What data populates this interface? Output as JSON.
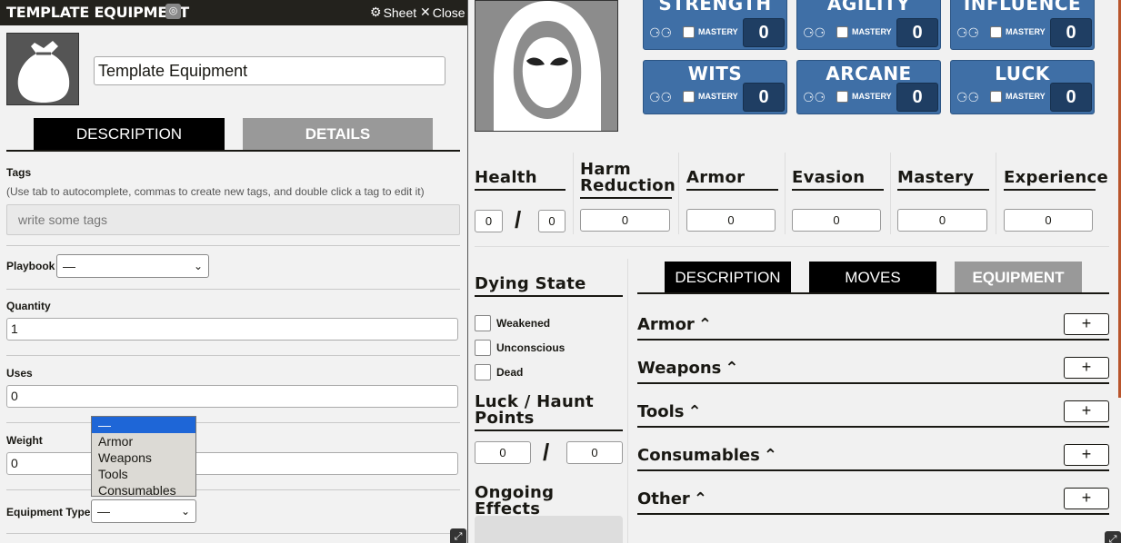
{
  "dialog": {
    "title": "TEMPLATE EQUIPMENT",
    "header_buttons": [
      {
        "icon": "gear-icon",
        "glyph": "⚙",
        "label": "Sheet"
      },
      {
        "icon": "close-icon",
        "glyph": "✕",
        "label": "Close"
      }
    ],
    "item_name": "Template Equipment",
    "tabs": [
      "DESCRIPTION",
      "DETAILS"
    ],
    "tags": {
      "label": "Tags",
      "hint": "(Use tab to autocomplete, commas to create new tags, and double click a tag to edit it)",
      "placeholder": "write some tags"
    },
    "playbook": {
      "label": "Playbook",
      "value": "—"
    },
    "quantity": {
      "label": "Quantity",
      "value": "1"
    },
    "uses": {
      "label": "Uses",
      "value": "0"
    },
    "weight": {
      "label": "Weight",
      "value": "0"
    },
    "equipment_type": {
      "label": "Equipment Type",
      "value": "—",
      "options": [
        "—",
        "Armor",
        "Weapons",
        "Tools",
        "Consumables"
      ],
      "selected_index": 0
    }
  },
  "sheet": {
    "stats": [
      {
        "name": "STRENGTH",
        "mastery_label": "MASTERY",
        "value": "0"
      },
      {
        "name": "AGILITY",
        "mastery_label": "MASTERY",
        "value": "0"
      },
      {
        "name": "INFLUENCE",
        "mastery_label": "MASTERY",
        "value": "0"
      },
      {
        "name": "WITS",
        "mastery_label": "MASTERY",
        "value": "0"
      },
      {
        "name": "ARCANE",
        "mastery_label": "MASTERY",
        "value": "0"
      },
      {
        "name": "LUCK",
        "mastery_label": "MASTERY",
        "value": "0"
      }
    ],
    "resources": {
      "health": {
        "label": "Health",
        "current": "0",
        "max": "0",
        "separator": "/"
      },
      "harm_reduction": {
        "label_line1": "Harm",
        "label_line2": "Reduction",
        "value": "0"
      },
      "armor": {
        "label": "Armor",
        "value": "0"
      },
      "evasion": {
        "label": "Evasion",
        "value": "0"
      },
      "mastery": {
        "label": "Mastery",
        "value": "0"
      },
      "experience": {
        "label": "Experience",
        "value": "0"
      }
    },
    "dying_state": {
      "label": "Dying State",
      "options": [
        "Weakened",
        "Unconscious",
        "Dead"
      ]
    },
    "luck_haunt": {
      "label_line1": "Luck / Haunt",
      "label_line2": "Points",
      "current": "0",
      "max": "0",
      "separator": "/"
    },
    "ongoing_effects": {
      "label": "Ongoing Effects"
    },
    "tabs": [
      "DESCRIPTION",
      "MOVES",
      "EQUIPMENT"
    ],
    "equipment_sections": [
      {
        "label": "Armor",
        "add": "+"
      },
      {
        "label": "Weapons",
        "add": "+"
      },
      {
        "label": "Tools",
        "add": "+"
      },
      {
        "label": "Consumables",
        "add": "+"
      },
      {
        "label": "Other",
        "add": "+"
      }
    ]
  },
  "colors": {
    "stat_blue": "#3f6fa6",
    "stat_value_bg": "#1f3e63",
    "titlebar": "#23221d",
    "tab_active": "#000000",
    "tab_inactive": "#999999",
    "dropdown_selected": "#1e66d7",
    "scroll_accent": "#b9552c"
  },
  "icons": {
    "portrait": "hooded-figure-icon",
    "item": "sack-icon",
    "dice": "dice-icon",
    "globe": "globe-icon",
    "chevron": "chevron-up-icon",
    "resize": "resize-handle-icon"
  }
}
